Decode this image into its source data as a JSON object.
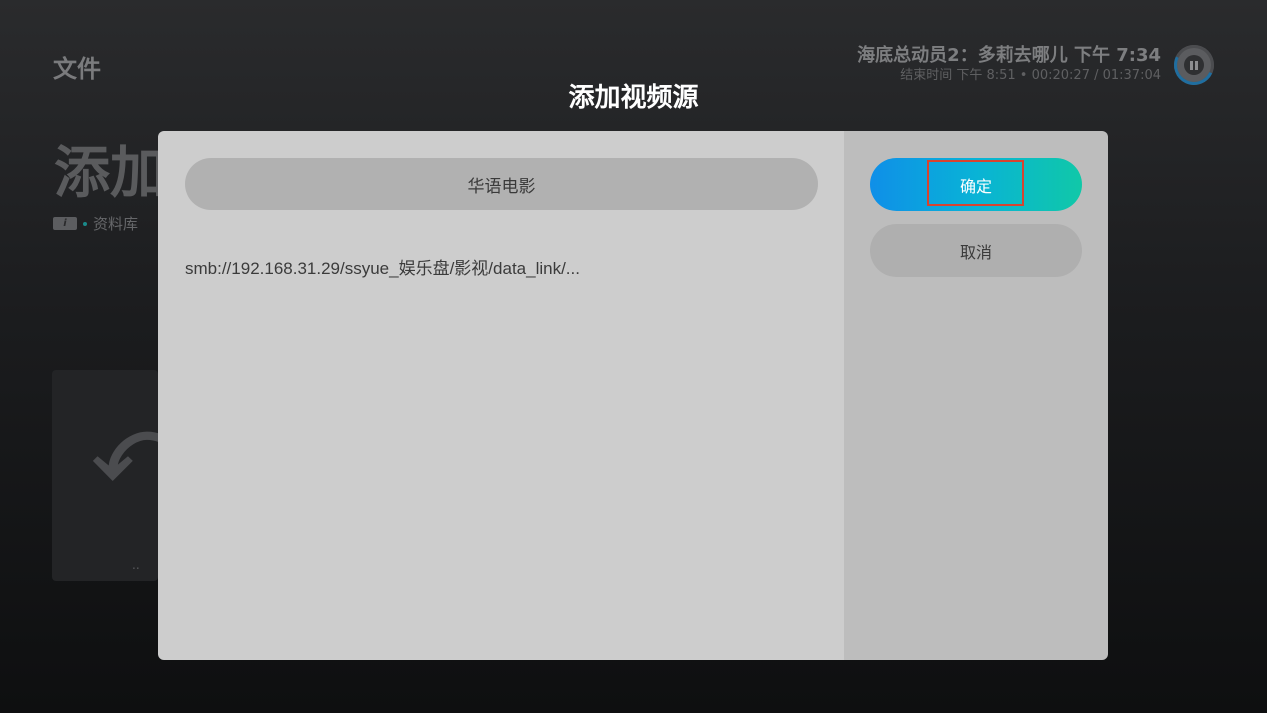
{
  "background": {
    "section_title": "文件",
    "page_heading": "添加视频源",
    "breadcrumb": {
      "badge": "i",
      "label": "资料库"
    },
    "up_tile": {
      "arrow": "⤺",
      "label": ".."
    }
  },
  "now_playing": {
    "title": "海底总动员2：多莉去哪儿 下午 7:34",
    "subtitle": "结束时间 下午 8:51 • 00:20:27 / 01:37:04",
    "icon": "pause-icon"
  },
  "dialog": {
    "title": "添加视频源",
    "name_value": "华语电影",
    "path": "smb://192.168.31.29/ssyue_娱乐盘/影视/data_link/...",
    "confirm_label": "确定",
    "cancel_label": "取消"
  },
  "colors": {
    "accent_start": "#0f8fe8",
    "accent_end": "#10c8a8",
    "focus_outline": "#d8432f"
  }
}
